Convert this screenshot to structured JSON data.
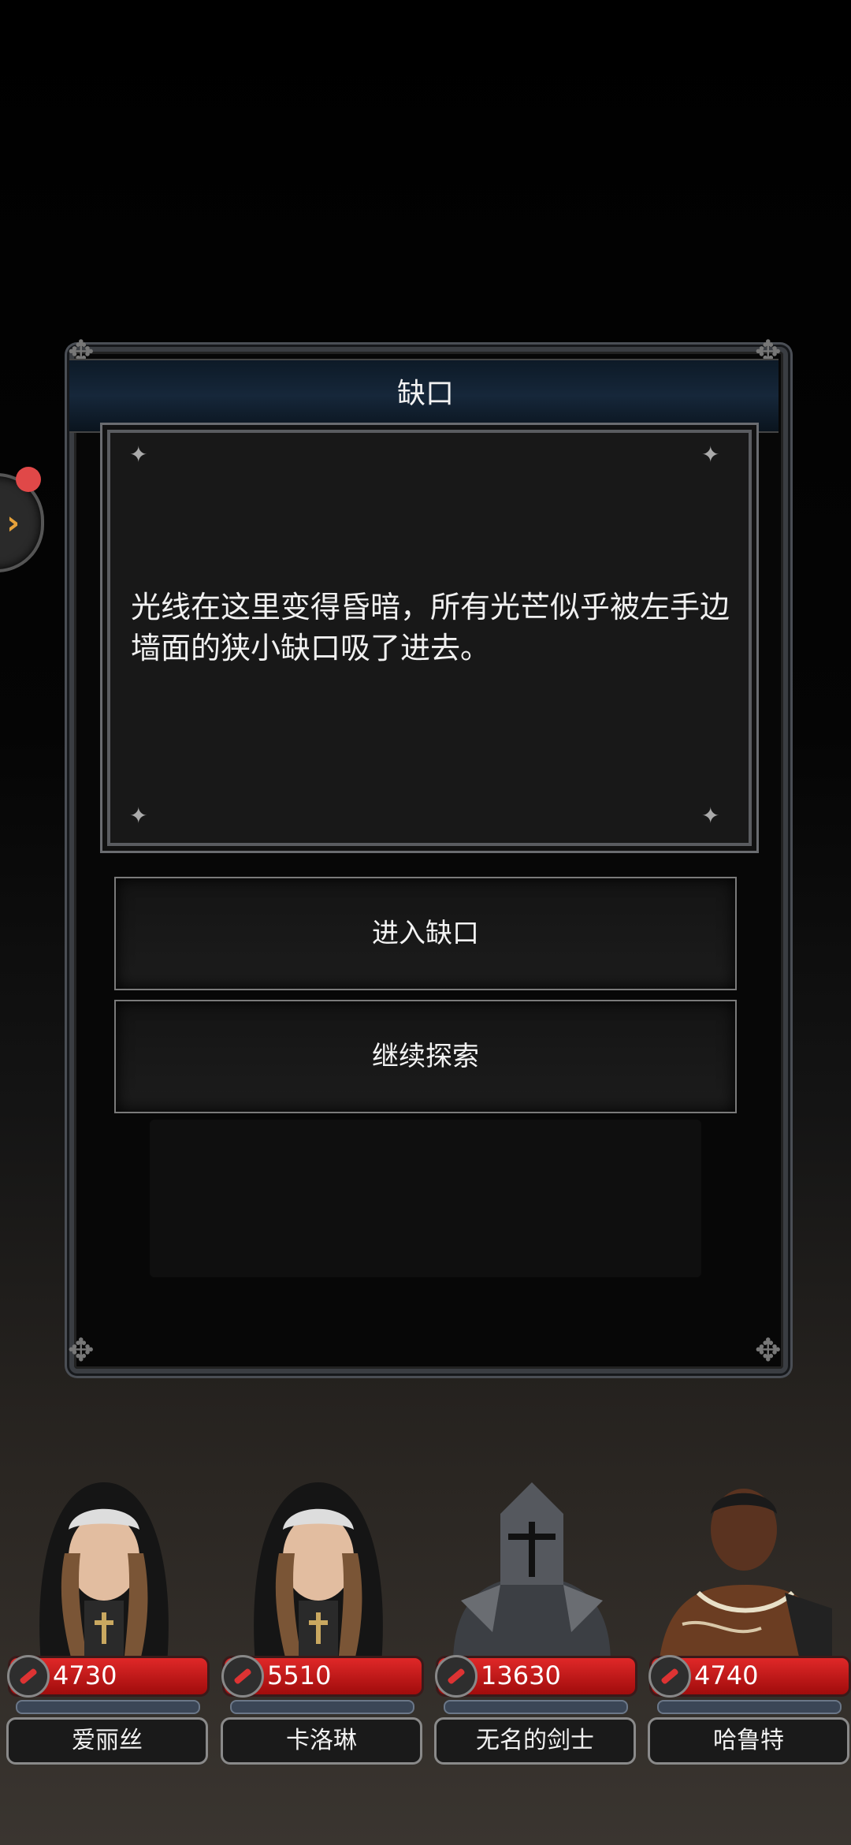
{
  "dialog": {
    "title": "缺口",
    "description": "光线在这里变得昏暗，所有光芒似乎被左手边墙面的狭小缺口吸了进去。",
    "options": [
      {
        "label": "进入缺口"
      },
      {
        "label": "继续探索"
      }
    ]
  },
  "side_toggle": {
    "icon": "chevron-right-icon",
    "notification": true
  },
  "party": [
    {
      "name": "爱丽丝",
      "hp": "4730",
      "portrait": "nun-portrait"
    },
    {
      "name": "卡洛琳",
      "hp": "5510",
      "portrait": "nun-portrait"
    },
    {
      "name": "无名的剑士",
      "hp": "13630",
      "portrait": "armored-knight-portrait"
    },
    {
      "name": "哈鲁特",
      "hp": "4740",
      "portrait": "warrior-portrait"
    }
  ],
  "colors": {
    "hp": "#d42020",
    "accent": "#e6a13a",
    "notify": "#e04848"
  }
}
